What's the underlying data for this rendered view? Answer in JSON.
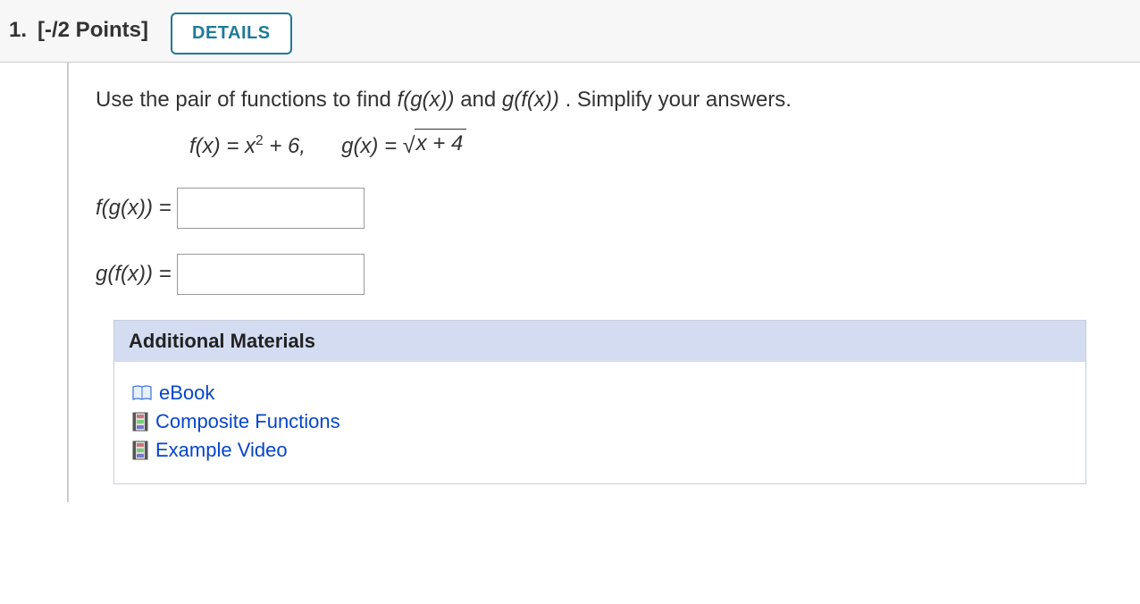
{
  "header": {
    "number": "1.",
    "points": "[-/2 Points]",
    "details_button": "DETAILS"
  },
  "question": {
    "instructions_pre": "Use the pair of functions to find ",
    "fg": "f(g(x))",
    "instructions_mid": " and ",
    "gf": "g(f(x))",
    "instructions_post": ".  Simplify your answers.",
    "f_def_lhs": "f(x) = x",
    "f_exp": "2",
    "f_def_rhs": " + 6,",
    "g_def_lhs": "g(x) = ",
    "g_radicand": "x + 4"
  },
  "answers": {
    "label1": "f(g(x)) =",
    "label2": "g(f(x)) ="
  },
  "materials": {
    "header": "Additional Materials",
    "items": [
      {
        "label": "eBook",
        "icon": "ebook"
      },
      {
        "label": "Composite Functions",
        "icon": "film"
      },
      {
        "label": "Example Video",
        "icon": "film"
      }
    ]
  }
}
